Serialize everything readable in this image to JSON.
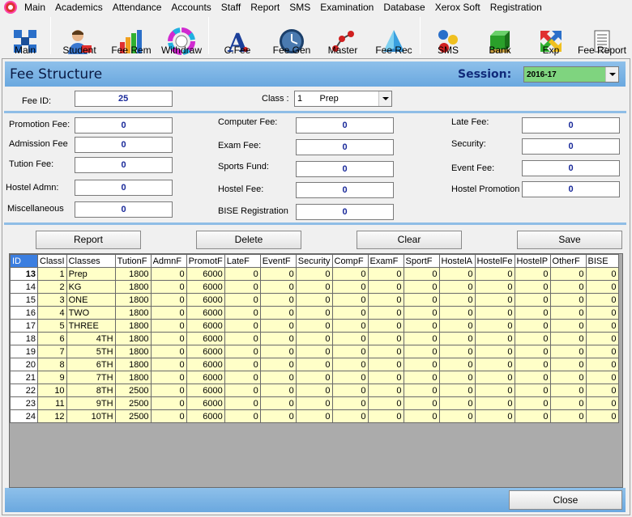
{
  "menu": [
    "Main",
    "Academics",
    "Attendance",
    "Accounts",
    "Staff",
    "Report",
    "SMS",
    "Examination",
    "Database",
    "Xerox Soft",
    "Registration"
  ],
  "toolbar": [
    {
      "label": "Main",
      "icon": "grid-squares-icon"
    },
    {
      "label": "Student",
      "icon": "student-icon"
    },
    {
      "label": "Fee Rem",
      "icon": "bar-chart-icon"
    },
    {
      "label": "Withdraw",
      "icon": "color-wheel-icon"
    },
    {
      "label": "C.Fee",
      "icon": "letter-a-icon"
    },
    {
      "label": "Fee Gen",
      "icon": "clock-icon"
    },
    {
      "label": "Master",
      "icon": "molecule-icon"
    },
    {
      "label": "Fee Rec",
      "icon": "pyramid-icon"
    },
    {
      "label": "SMS",
      "icon": "balls-icon"
    },
    {
      "label": "Bank",
      "icon": "bank-box-icon"
    },
    {
      "label": "Exp",
      "icon": "arrows-icon"
    },
    {
      "label": "Fee Report",
      "icon": "document-icon"
    }
  ],
  "form": {
    "title": "Fee Structure",
    "session_label": "Session:",
    "session_value": "2016-17",
    "fee_id_label": "Fee ID:",
    "fee_id_value": "25",
    "class_label": "Class :",
    "class_value": "1       Prep",
    "col1": [
      {
        "label": "Promotion Fee:",
        "value": "0"
      },
      {
        "label": "Admission Fee",
        "value": "0"
      },
      {
        "label": "Tution Fee:",
        "value": "0"
      },
      {
        "label": "Hostel  Admn:",
        "value": "0"
      },
      {
        "label": "Miscellaneous",
        "value": "0"
      }
    ],
    "col2": [
      {
        "label": "Computer Fee:",
        "value": "0"
      },
      {
        "label": "Exam Fee:",
        "value": "0"
      },
      {
        "label": "Sports Fund:",
        "value": "0"
      },
      {
        "label": "Hostel Fee:",
        "value": "0"
      },
      {
        "label": "BISE Registration",
        "value": "0"
      }
    ],
    "col3": [
      {
        "label": "Late Fee:",
        "value": "0"
      },
      {
        "label": "Security:",
        "value": "0"
      },
      {
        "label": "Event Fee:",
        "value": "0"
      },
      {
        "label": "Hostel Promotion",
        "value": "0"
      }
    ]
  },
  "buttons": {
    "report": "Report",
    "delete": "Delete",
    "clear": "Clear",
    "save": "Save",
    "close": "Close"
  },
  "grid": {
    "columns": [
      "ID",
      "ClassI",
      "Classes",
      "TutionF",
      "AdmnF",
      "PromotF",
      "LateF",
      "EventF",
      "Security",
      "CompF",
      "ExamF",
      "SportF",
      "HostelA",
      "HostelFe",
      "HostelP",
      "OtherF",
      "BISE"
    ],
    "rows": [
      [
        "13",
        "1",
        "Prep",
        "1800",
        "0",
        "6000",
        "0",
        "0",
        "0",
        "0",
        "0",
        "0",
        "0",
        "0",
        "0",
        "0",
        "0"
      ],
      [
        "14",
        "2",
        "KG",
        "1800",
        "0",
        "6000",
        "0",
        "0",
        "0",
        "0",
        "0",
        "0",
        "0",
        "0",
        "0",
        "0",
        "0"
      ],
      [
        "15",
        "3",
        "ONE",
        "1800",
        "0",
        "6000",
        "0",
        "0",
        "0",
        "0",
        "0",
        "0",
        "0",
        "0",
        "0",
        "0",
        "0"
      ],
      [
        "16",
        "4",
        "TWO",
        "1800",
        "0",
        "6000",
        "0",
        "0",
        "0",
        "0",
        "0",
        "0",
        "0",
        "0",
        "0",
        "0",
        "0"
      ],
      [
        "17",
        "5",
        "THREE",
        "1800",
        "0",
        "6000",
        "0",
        "0",
        "0",
        "0",
        "0",
        "0",
        "0",
        "0",
        "0",
        "0",
        "0"
      ],
      [
        "18",
        "6",
        "4TH",
        "1800",
        "0",
        "6000",
        "0",
        "0",
        "0",
        "0",
        "0",
        "0",
        "0",
        "0",
        "0",
        "0",
        "0"
      ],
      [
        "19",
        "7",
        "5TH",
        "1800",
        "0",
        "6000",
        "0",
        "0",
        "0",
        "0",
        "0",
        "0",
        "0",
        "0",
        "0",
        "0",
        "0"
      ],
      [
        "20",
        "8",
        "6TH",
        "1800",
        "0",
        "6000",
        "0",
        "0",
        "0",
        "0",
        "0",
        "0",
        "0",
        "0",
        "0",
        "0",
        "0"
      ],
      [
        "21",
        "9",
        "7TH",
        "1800",
        "0",
        "6000",
        "0",
        "0",
        "0",
        "0",
        "0",
        "0",
        "0",
        "0",
        "0",
        "0",
        "0"
      ],
      [
        "22",
        "10",
        "8TH",
        "2500",
        "0",
        "6000",
        "0",
        "0",
        "0",
        "0",
        "0",
        "0",
        "0",
        "0",
        "0",
        "0",
        "0"
      ],
      [
        "23",
        "11",
        "9TH",
        "2500",
        "0",
        "6000",
        "0",
        "0",
        "0",
        "0",
        "0",
        "0",
        "0",
        "0",
        "0",
        "0",
        "0"
      ],
      [
        "24",
        "12",
        "10TH",
        "2500",
        "0",
        "6000",
        "0",
        "0",
        "0",
        "0",
        "0",
        "0",
        "0",
        "0",
        "0",
        "0",
        "0"
      ]
    ]
  }
}
